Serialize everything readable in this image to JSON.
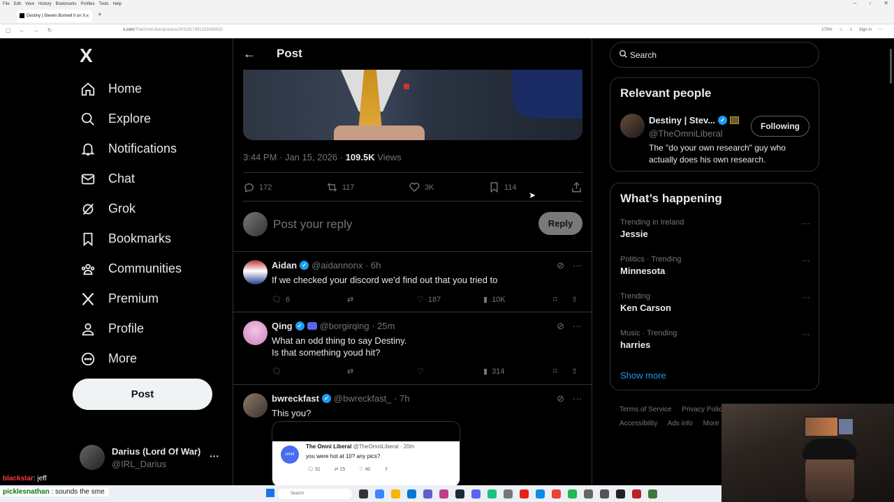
{
  "browser": {
    "menu": [
      "File",
      "Edit",
      "View",
      "History",
      "Bookmarks",
      "Profiles",
      "Tools",
      "Help"
    ],
    "tab_title": "Destiny | Steven Bonnell II on X",
    "url_host": "x.com",
    "url_path": "/TheOmniLiberal/status/2011917391203086533",
    "zoom": "170%",
    "signin": "Sign in"
  },
  "sidebar": {
    "logo": "X",
    "items": [
      {
        "label": "Home",
        "icon": "home-icon"
      },
      {
        "label": "Explore",
        "icon": "search-icon"
      },
      {
        "label": "Notifications",
        "icon": "bell-icon"
      },
      {
        "label": "Chat",
        "icon": "mail-icon"
      },
      {
        "label": "Grok",
        "icon": "grok-icon"
      },
      {
        "label": "Bookmarks",
        "icon": "bookmark-icon"
      },
      {
        "label": "Communities",
        "icon": "communities-icon"
      },
      {
        "label": "Premium",
        "icon": "x-premium-icon"
      },
      {
        "label": "Profile",
        "icon": "person-icon"
      },
      {
        "label": "More",
        "icon": "more-circle-icon"
      }
    ],
    "post_label": "Post",
    "account": {
      "name": "Darius (Lord Of War)",
      "handle": "@IRL_Darius"
    }
  },
  "main": {
    "header_title": "Post",
    "meta": {
      "time": "3:44 PM · Jan 15, 2026 · ",
      "views_count": "109.5K",
      "views_label": "Views"
    },
    "actions": {
      "replies": "172",
      "reposts": "117",
      "likes": "3K",
      "bookmarks": "114"
    },
    "reply_placeholder": "Post your reply",
    "reply_button": "Reply",
    "tweets": [
      {
        "name": "Aidan",
        "handle": "@aidannonx · 6h",
        "text": "If we checked your discord we'd find out that you tried to",
        "replies": "6",
        "reposts": "",
        "likes": "187",
        "views": "10K"
      },
      {
        "name": "Qing",
        "handle": "@borgirqing · 25m",
        "text_line1": "What an odd thing to say Destiny.",
        "text_line2": "Is that something youd hit?",
        "replies": "",
        "reposts": "",
        "likes": "",
        "views": "314"
      },
      {
        "name": "bwreckfast",
        "handle": "@bwreckfast_ · 7h",
        "text": "This you?",
        "quote": {
          "logo_text": "omni",
          "name": "The Omni Liberal",
          "handle": "@TheOmniLiberal · 20m",
          "text": "you were hot at 10? any pics?",
          "replies": "31",
          "reposts": "15",
          "likes": "40"
        }
      }
    ]
  },
  "right": {
    "search_placeholder": "Search",
    "relevant": {
      "title": "Relevant people",
      "name": "Destiny | Stev...",
      "handle": "@TheOmniLiberal",
      "bio": "The \"do your own research\" guy who actually does his own research.",
      "follow_label": "Following"
    },
    "happening": {
      "title": "What’s happening",
      "trends": [
        {
          "meta": "Trending in Ireland",
          "name": "Jessie"
        },
        {
          "meta": "Politics · Trending",
          "name": "Minnesota"
        },
        {
          "meta": "Trending",
          "name": "Ken Carson"
        },
        {
          "meta": "Music · Trending",
          "name": "harries"
        }
      ],
      "show_more": "Show more"
    },
    "footer": [
      "Terms of Service",
      "Privacy Policy",
      "Accessibility",
      "Ads info",
      "More"
    ]
  },
  "taskbar": {
    "search_placeholder": "Search"
  },
  "stream_chat": [
    {
      "user": "blackstar",
      "sep": ": ",
      "text": "jeff"
    },
    {
      "user": "picklesnathan",
      "sep": " : ",
      "text": "sounds the sme"
    }
  ],
  "colors": {
    "accent": "#1d9bf0",
    "background": "#000000",
    "border": "#2f3336",
    "muted": "#71767b"
  }
}
